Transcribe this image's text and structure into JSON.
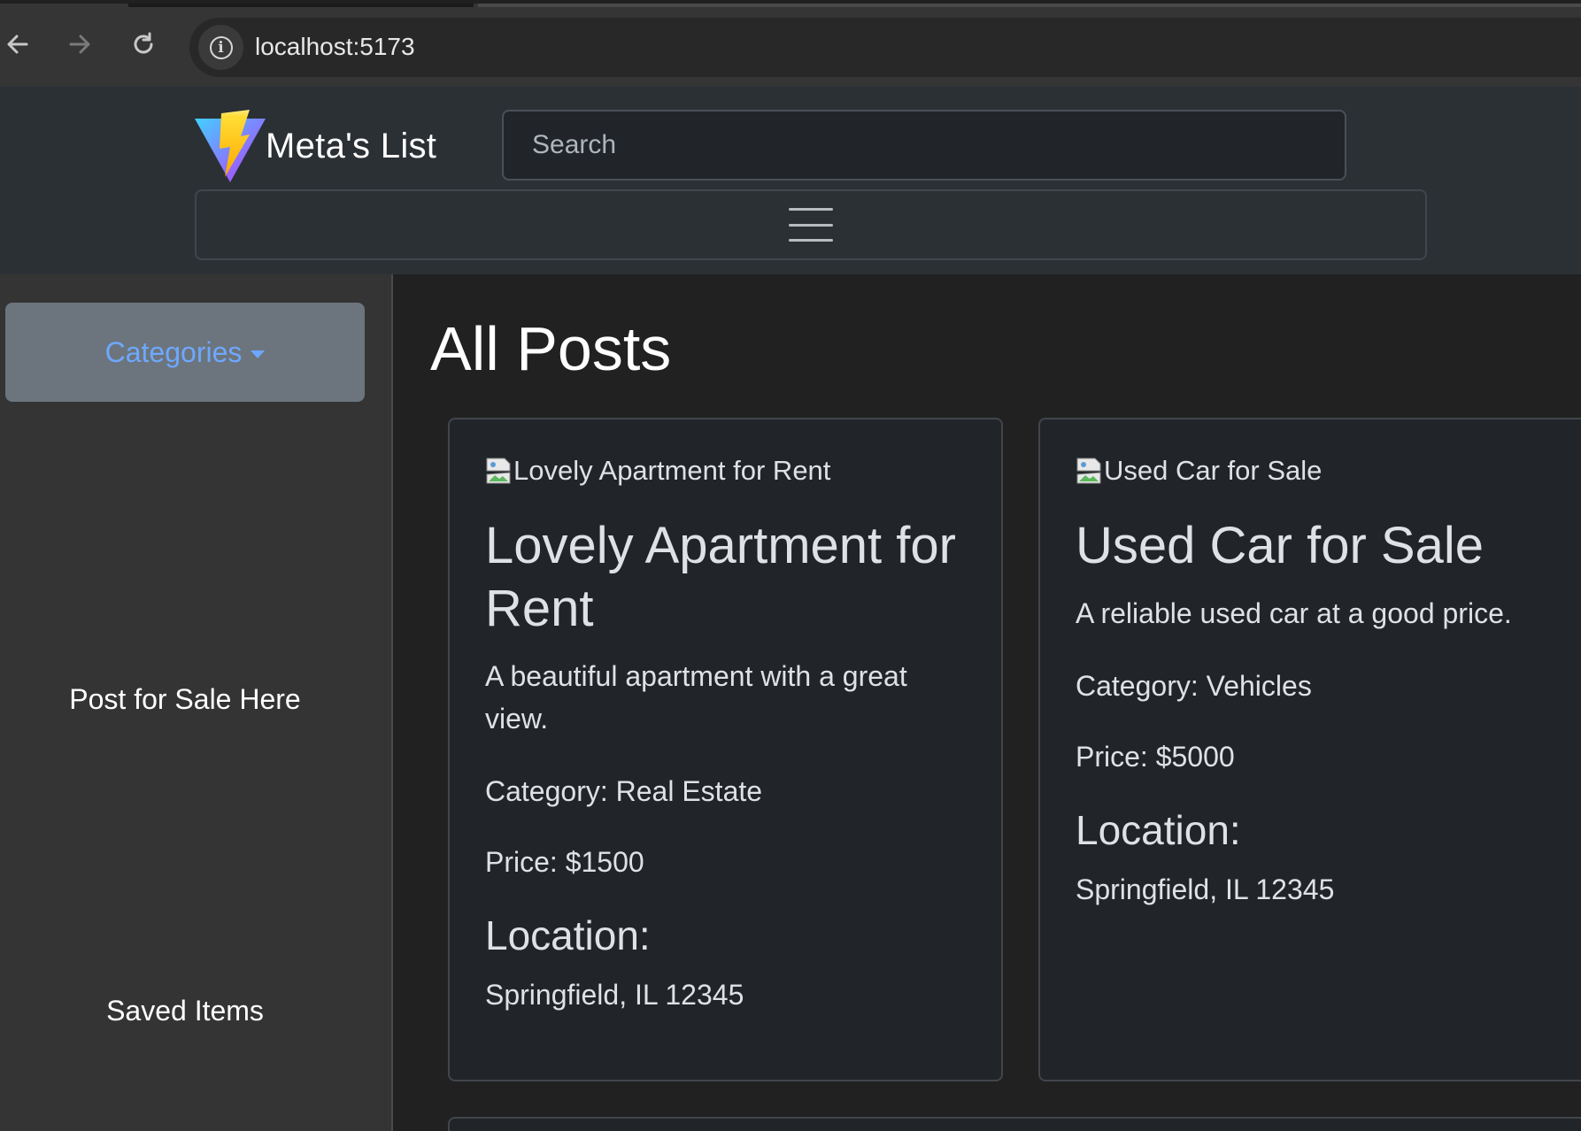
{
  "browser": {
    "url": "localhost:5173"
  },
  "navbar": {
    "brand_name": "Meta's List",
    "search_placeholder": "Search"
  },
  "sidebar": {
    "categories_label": "Categories",
    "items": [
      {
        "label": "Post for Sale Here"
      },
      {
        "label": "Saved Items"
      }
    ]
  },
  "main": {
    "title": "All Posts",
    "posts": [
      {
        "image_alt": "Lovely Apartment for Rent",
        "title": "Lovely Apartment for Rent",
        "description": "A beautiful apartment with a great view.",
        "category": "Category: Real Estate",
        "price": "Price: $1500",
        "location_heading": "Location:",
        "location": "Springfield, IL 12345"
      },
      {
        "image_alt": "Used Car for Sale",
        "title": "Used Car for Sale",
        "description": "A reliable used car at a good price.",
        "category": "Category: Vehicles",
        "price": "Price: $5000",
        "location_heading": "Location:",
        "location": "Springfield, IL 12345"
      }
    ]
  },
  "colors": {
    "accent_link": "#6ea8fe",
    "categories_bg": "#6c757d",
    "card_bg": "#212529",
    "navbar_bg": "#2b3035"
  },
  "icons": [
    "back-arrow-icon",
    "forward-arrow-icon",
    "reload-icon",
    "site-info-icon",
    "vite-logo",
    "hamburger-icon",
    "caret-down-icon",
    "broken-image-icon"
  ]
}
